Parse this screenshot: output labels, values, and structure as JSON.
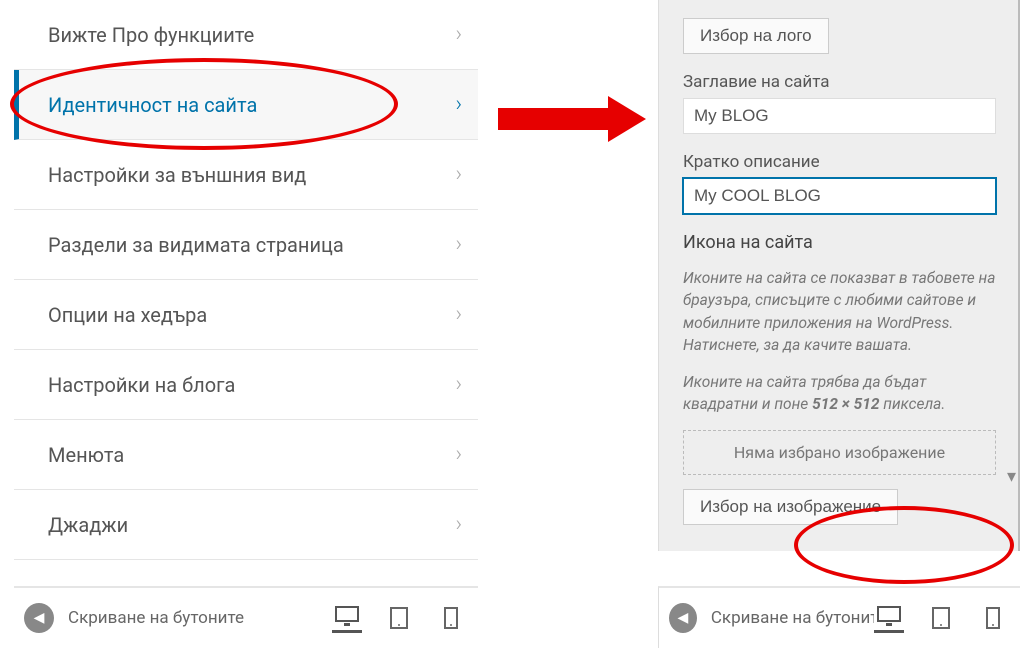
{
  "menu": {
    "items": [
      {
        "label": "Вижте Про функциите",
        "name": "menu-pro-features"
      },
      {
        "label": "Идентичност на сайта",
        "name": "menu-site-identity",
        "active": true
      },
      {
        "label": "Настройки за външния вид",
        "name": "menu-appearance"
      },
      {
        "label": "Раздели за видимата страница",
        "name": "menu-frontpage-sections"
      },
      {
        "label": "Опции на хедъра",
        "name": "menu-header-options"
      },
      {
        "label": "Настройки на блога",
        "name": "menu-blog-settings"
      },
      {
        "label": "Менюта",
        "name": "menu-menus"
      },
      {
        "label": "Джаджи",
        "name": "menu-widgets"
      }
    ]
  },
  "identity": {
    "select_logo_label": "Избор на лого",
    "site_title_label": "Заглавие на сайта",
    "site_title_value": "My BLOG",
    "tagline_label": "Кратко описание",
    "tagline_value": "My COOL BLOG",
    "site_icon_label": "Икона на сайта",
    "icon_help1": "Иконите на сайта се показват в табовете на браузъра, списъците с любими сайтове и мобилните приложения на WordPress. Натиснете, за да качите вашата.",
    "icon_help2_a": "Иконите на сайта трябва да бъдат квадратни и поне ",
    "icon_help2_b": "512 × 512",
    "icon_help2_c": " пиксела.",
    "no_image": "Няма избрано изображение",
    "select_image_label": "Избор на изображение"
  },
  "footer": {
    "collapse_left": "Скриване на бутоните",
    "collapse_right": "Скриване на бутоните"
  }
}
